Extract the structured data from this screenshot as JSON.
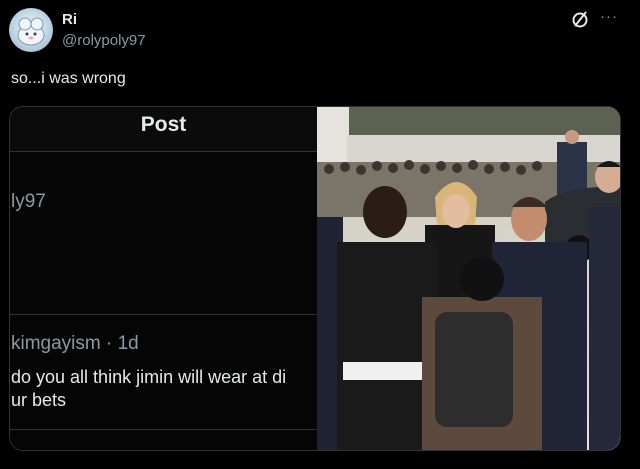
{
  "author": {
    "display_name": "Ri",
    "handle": "@rolypoly97",
    "avatar_icon": "avatar-cartoon-icon"
  },
  "actions": {
    "grok_icon": "grok-slash-circle-icon",
    "more_icon": "more-horizontal-icon",
    "more_label": "···"
  },
  "tweet": {
    "text": "so...i was wrong"
  },
  "screenshot": {
    "title": "Post",
    "partial_handle": "ly97",
    "reply_user": "kimgayism · 1d",
    "reply_line1": "do you all think jimin will wear at di",
    "reply_line2": "ur bets"
  },
  "photo": {
    "description_icon": "event-photo"
  },
  "colors": {
    "background": "#000000",
    "text_primary": "#e7e9ea",
    "text_secondary": "#8b98a5",
    "border": "#2f3336"
  }
}
